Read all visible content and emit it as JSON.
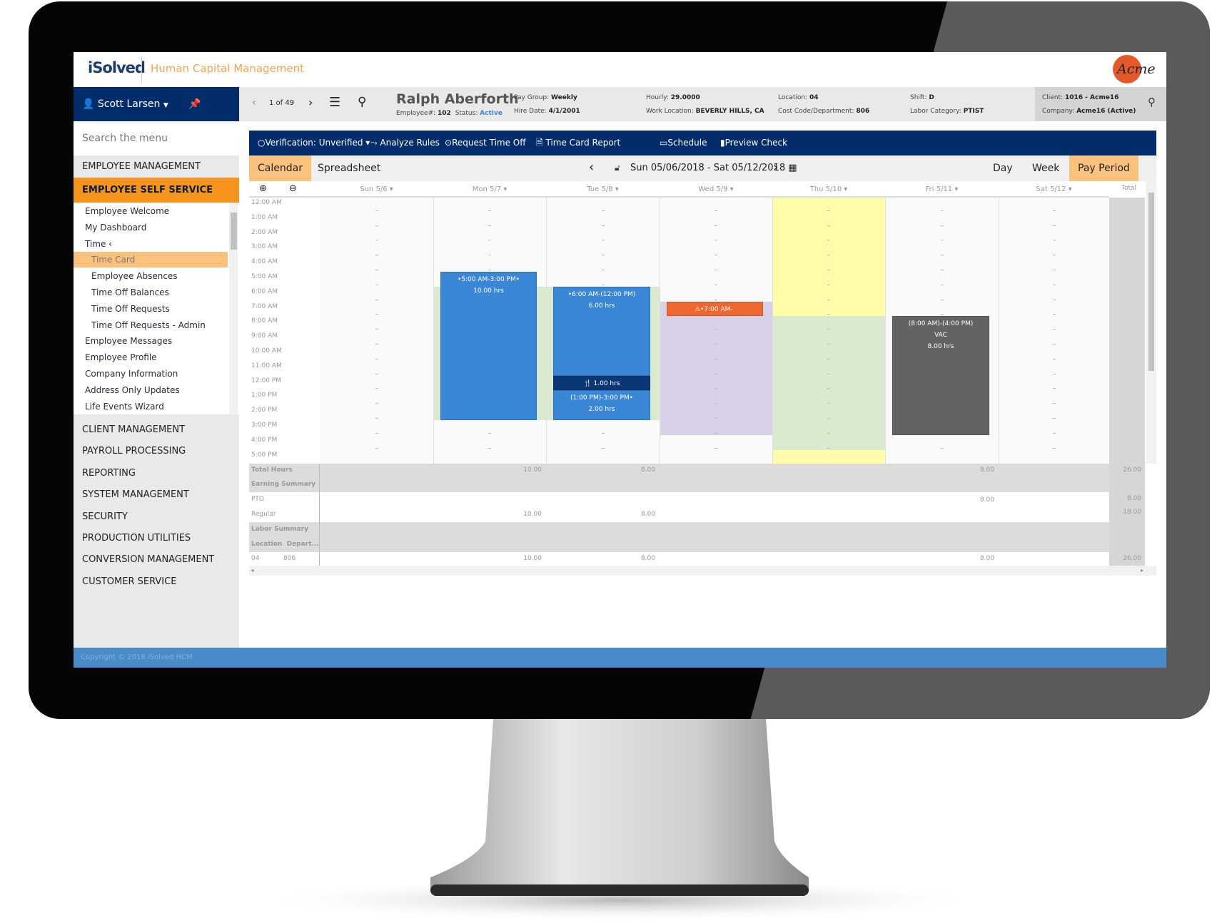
{
  "header": {
    "logo": "iSolved",
    "app_name": "Human Capital Management",
    "client_logo": "Acme"
  },
  "user": {
    "name": "Scott Larsen",
    "user_icon": "user-icon",
    "pin_icon": "pin-icon"
  },
  "sidebar": {
    "search_placeholder": "Search the menu",
    "sections_top": [
      "EMPLOYEE MANAGEMENT",
      "EMPLOYEE SELF SERVICE"
    ],
    "submenu": [
      {
        "label": "Employee Welcome",
        "level": 1
      },
      {
        "label": "My Dashboard",
        "level": 1
      },
      {
        "label": "Time  ‹",
        "level": 1
      },
      {
        "label": "Time Card",
        "level": 2,
        "active": true
      },
      {
        "label": "Employee Absences",
        "level": 2
      },
      {
        "label": "Time Off Balances",
        "level": 2
      },
      {
        "label": "Time Off Requests",
        "level": 2
      },
      {
        "label": "Time Off Requests - Admin",
        "level": 2
      },
      {
        "label": "Employee Messages",
        "level": 1
      },
      {
        "label": "Employee Profile",
        "level": 1
      },
      {
        "label": "Company Information",
        "level": 1
      },
      {
        "label": "Address Only Updates",
        "level": 1
      },
      {
        "label": "Life Events Wizard",
        "level": 1
      }
    ],
    "sections_bottom": [
      "CLIENT MANAGEMENT",
      "PAYROLL PROCESSING",
      "REPORTING",
      "SYSTEM MANAGEMENT",
      "SECURITY",
      "PRODUCTION UTILITIES",
      "CONVERSION MANAGEMENT",
      "CUSTOMER SERVICE"
    ]
  },
  "employee": {
    "pager": "1 of 49",
    "name": "Ralph Aberforth",
    "employee_no_label": "Employee#:",
    "employee_no": "102",
    "status_label": "Status:",
    "status": "Active",
    "pay_group_label": "Pay Group:",
    "pay_group": "Weekly",
    "hire_date_label": "Hire Date:",
    "hire_date": "4/1/2001",
    "hourly_label": "Hourly:",
    "hourly": "29.0000",
    "work_location_label": "Work Location:",
    "work_location": "BEVERLY HILLS, CA",
    "location_label": "Location:",
    "location": "04",
    "cost_code_label": "Cost Code/Department:",
    "cost_code": "806",
    "shift_label": "Shift:",
    "shift": "D",
    "labor_category_label": "Labor Category:",
    "labor_category": "PTIST",
    "client_label": "Client:",
    "client": "1016 - Acme16",
    "company_label": "Company:",
    "company": "Acme16 (Active)"
  },
  "toolbar": {
    "verification": "Verification: Unverified",
    "analyze": "Analyze Rules",
    "request_time_off": "Request Time Off",
    "time_card_report": "Time Card Report",
    "schedule": "Schedule",
    "preview_check": "Preview Check"
  },
  "tabs": {
    "calendar": "Calendar",
    "spreadsheet": "Spreadsheet",
    "date_range": "Sun 05/06/2018 - Sat 05/12/2018",
    "day": "Day",
    "week": "Week",
    "pay_period": "Pay Period",
    "active_view": "Pay Period"
  },
  "calendar": {
    "days": [
      "Sun 5/6 ▾",
      "Mon 5/7 ▾",
      "Tue 5/8 ▾",
      "Wed 5/9 ▾",
      "Thu 5/10 ▾",
      "Fri 5/11 ▾",
      "Sat 5/12 ▾"
    ],
    "total_label": "Total",
    "hours": [
      "12:00 AM",
      "1:00 AM",
      "2:00 AM",
      "3:00 AM",
      "4:00 AM",
      "5:00 AM",
      "6:00 AM",
      "7:00 AM",
      "8:00 AM",
      "9:00 AM",
      "10:00 AM",
      "11:00 AM",
      "12:00 PM",
      "1:00 PM",
      "2:00 PM",
      "3:00 PM",
      "4:00 PM",
      "5:00 PM"
    ],
    "backgrounds": [
      {
        "day": 1,
        "start": 6,
        "end": 15,
        "color": "#d9ead0"
      },
      {
        "day": 2,
        "start": 6,
        "end": 15,
        "color": "#d9ead0"
      },
      {
        "day": 3,
        "start": 7,
        "end": 16,
        "color": "#d8d0e6"
      },
      {
        "day": 4,
        "start": 0,
        "end": 8,
        "color": "#fffcaa"
      },
      {
        "day": 4,
        "start": 8,
        "end": 17,
        "color": "#d9ead0"
      },
      {
        "day": 4,
        "start": 17,
        "end": 18,
        "color": "#fffcaa"
      }
    ],
    "events": [
      {
        "day": 1,
        "start": 5,
        "end": 15,
        "color": "#3a87d8",
        "lines": [
          "•5:00 AM-3:00 PM•",
          "10.00 hrs"
        ]
      },
      {
        "day": 2,
        "start": 6,
        "end": 12,
        "color": "#3a87d8",
        "lines": [
          "•6:00 AM-(12:00 PM)",
          "6.00 hrs"
        ]
      },
      {
        "day": 2,
        "start": 12,
        "end": 13,
        "color": "#0b3776",
        "lines": [
          "🍴 1.00 hrs"
        ]
      },
      {
        "day": 2,
        "start": 13,
        "end": 15,
        "color": "#3a87d8",
        "lines": [
          "(1:00 PM)-3:00 PM•",
          "2.00 hrs"
        ]
      },
      {
        "day": 3,
        "start": 7,
        "end": 8,
        "color": "#ee6730",
        "lines": [
          "⚠•7:00 AM-"
        ]
      },
      {
        "day": 5,
        "start": 8,
        "end": 16,
        "color": "#636363",
        "lines": [
          "(8:00 AM)-(4:00 PM)",
          "VAC",
          "8.00 hrs"
        ]
      }
    ]
  },
  "summary": {
    "total_hours_label": "Total Hours",
    "total_hours": {
      "mon": "10.00",
      "tue": "8.00",
      "fri": "8.00",
      "total": "26.00"
    },
    "earning_summary_label": "Earning Summary",
    "pto_label": "PTO",
    "pto": {
      "fri": "8.00",
      "total": "8.00"
    },
    "regular_label": "Regular",
    "regular": {
      "mon": "10.00",
      "tue": "8.00",
      "total": "18.00"
    },
    "labor_summary_label": "Labor Summary",
    "location_col": "Location",
    "department_col": "Depart...",
    "labor_row": {
      "location": "04",
      "department": "806",
      "mon": "10.00",
      "tue": "8.00",
      "fri": "8.00",
      "total": "26.00"
    }
  },
  "footer": {
    "copyright": "Copyright © 2018 iSolved HCM"
  },
  "colors": {
    "navy": "#022d6a",
    "orange": "#f7941d",
    "light_orange": "#fbc27e",
    "footer_blue": "#4a8bc9"
  }
}
